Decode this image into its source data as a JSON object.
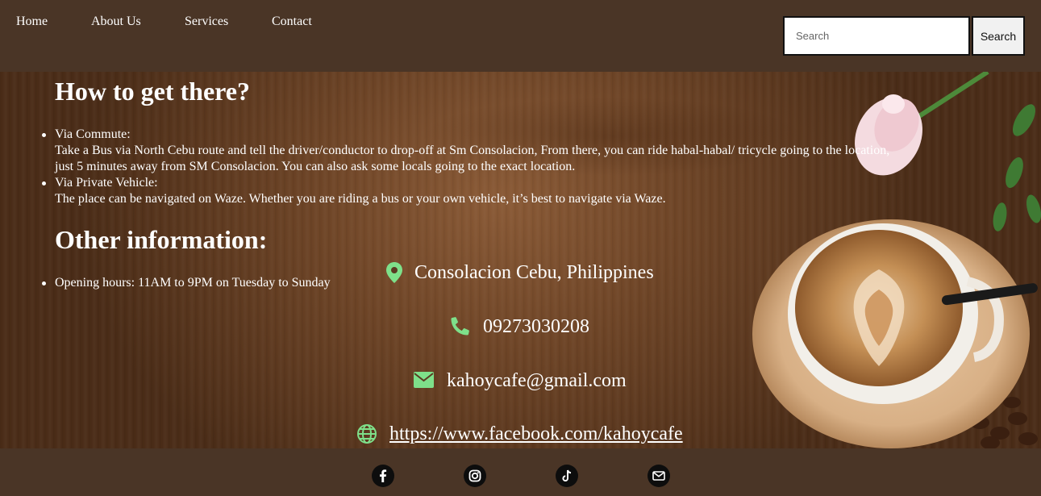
{
  "nav": {
    "items": [
      "Home",
      "About Us",
      "Services",
      "Contact"
    ],
    "search_placeholder": "Search",
    "search_button": "Search"
  },
  "directions": {
    "title": "How to get there?",
    "items": [
      {
        "label": "Via Commute:",
        "text": "Take a Bus via North Cebu route and tell the driver/conductor to drop-off at Sm Consolacion, From there, you can ride habal-habal/ tricycle going to the location, just 5 minutes away from SM Consolacion. You can also ask some locals going to the exact location."
      },
      {
        "label": "Via Private Vehicle:",
        "text": "The place can be navigated on Waze. Whether you are riding a bus or your own vehicle, it’s best to navigate via Waze."
      }
    ]
  },
  "other": {
    "title": "Other information:",
    "items": [
      "Opening hours: 11AM to 9PM on Tuesday to Sunday"
    ]
  },
  "contact": {
    "location": "Consolacion Cebu, Philippines",
    "phone": "09273030208",
    "email": "kahoycafe@gmail.com",
    "facebook": "https://www.facebook.com/kahoycafe",
    "icon_color": "#7ee08a"
  },
  "footer": {
    "icons": [
      "facebook-icon",
      "instagram-icon",
      "tiktok-icon",
      "mail-icon"
    ]
  }
}
